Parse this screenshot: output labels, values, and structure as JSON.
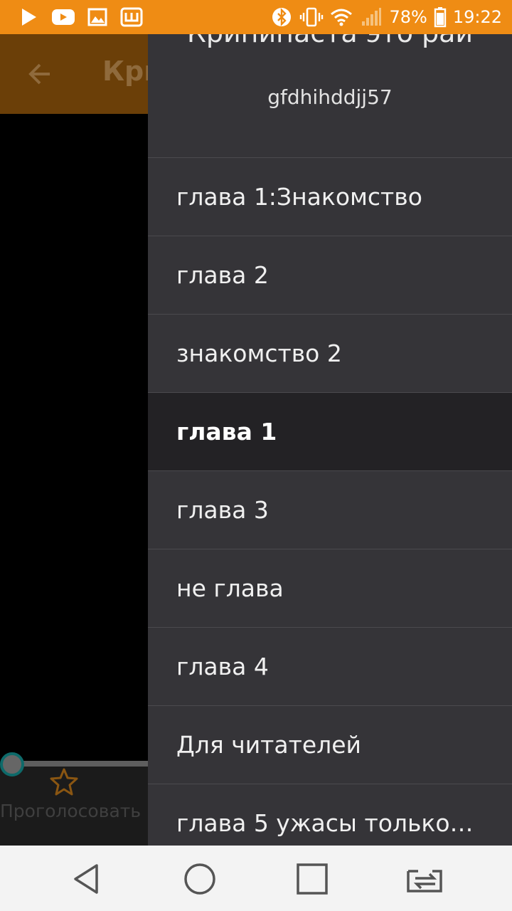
{
  "status_bar": {
    "battery_percent": "78%",
    "time": "19:22",
    "left_icons": [
      "play-store-icon",
      "youtube-icon",
      "gallery-icon",
      "app-w-icon"
    ],
    "right_icons": [
      "bluetooth-icon",
      "vibrate-icon",
      "wifi-icon",
      "signal-icon",
      "battery-icon"
    ],
    "background_color": "#ef8c14"
  },
  "background_app": {
    "toolbar_title": "Кри",
    "vote_label": "Проголосовать",
    "toolbar_color": "#6b3f08"
  },
  "drawer": {
    "story_title": "Крипипаста это рай",
    "author": "gfdhihddjj57",
    "chapters": [
      {
        "label": "глава 1:Знакомство",
        "selected": false
      },
      {
        "label": "глава 2",
        "selected": false
      },
      {
        "label": "знакомство 2",
        "selected": false
      },
      {
        "label": "глава 1",
        "selected": true
      },
      {
        "label": "глава 3",
        "selected": false
      },
      {
        "label": "не глава",
        "selected": false
      },
      {
        "label": "глава 4",
        "selected": false
      },
      {
        "label": "Для читателей",
        "selected": false
      },
      {
        "label": "глава 5 ужасы только…",
        "selected": false
      }
    ],
    "background_color": "#353438",
    "selected_color": "#232225"
  },
  "nav_bar": {
    "buttons": [
      "back-icon",
      "home-icon",
      "recents-icon",
      "switch-apps-icon"
    ]
  }
}
